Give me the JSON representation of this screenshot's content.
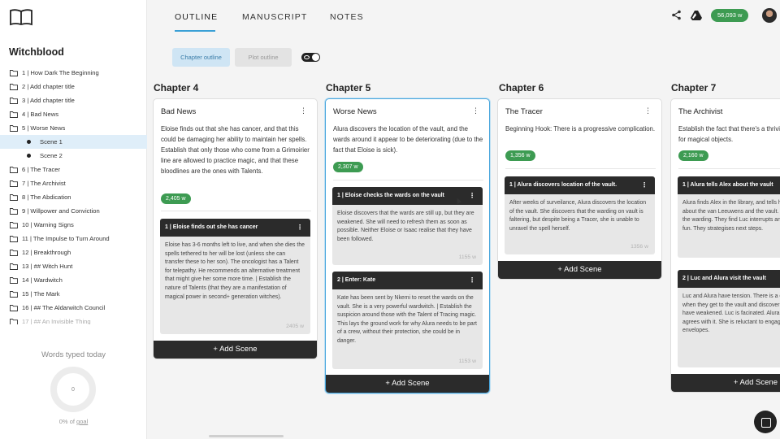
{
  "sidebar": {
    "project_title": "Witchblood",
    "chapters": [
      "1 | How Dark The Beginning",
      "2 | Add chapter title",
      "3 | Add chapter title",
      "4 | Bad News",
      "5 | Worse News",
      "6 | The Tracer",
      "7 | The Archivist",
      "8 | The Abdication",
      "9 | Willpower and Conviction",
      "10 | Warning Signs",
      "11 | The Impulse to Turn Around",
      "12 | Breakthrough",
      "13 | ## Witch Hunt",
      "14 | Wardwitch",
      "15 | The Mark",
      "16 | ## The Aldarwitch Council",
      "17 | ## An Invisible Thing"
    ],
    "scenes": [
      "Scene 1",
      "Scene 2"
    ],
    "words_label": "Words typed today",
    "words_value": "0",
    "goal_prefix": "0% of",
    "goal_link": "goal"
  },
  "tabs": [
    "OUTLINE",
    "MANUSCRIPT",
    "NOTES"
  ],
  "header": {
    "word_count": "56,093 w"
  },
  "toggles": {
    "chapter_outline": "Chapter outline",
    "plot_outline": "Plot outline"
  },
  "add_scene_label": "+ Add Scene",
  "columns": [
    {
      "chapter": "Chapter 4",
      "title": "Bad News",
      "summary": "Eloise finds out that she has cancer, and that this could be damaging her ability to maintain her spells. Establish that only those who come from a Grimoirier line are allowed to practice magic, and that these bloodlines are the ones with Talents.",
      "words": "2,405 w",
      "scenes": [
        {
          "title": "1 | Eloise finds out she has cancer",
          "body": "Eloise has 3-6 months left to live, and when she dies the spells tethered to her will be lost (unless she can transfer these to her son). The oncologist has a Talent for telepathy. He recommends an alternative treatment that might give her some more time. | Establish the nature of Talents (that they are a manifestation of magical power in second+ generation witches).",
          "words": "2405 w"
        }
      ]
    },
    {
      "chapter": "Chapter 5",
      "title": "Worse News",
      "summary": "Alura discovers the location of the vault, and the wards around it appear to be deteriorating (due to the fact that Eloise is sick).",
      "words": "2,307 w",
      "scenes": [
        {
          "title": "1 | Eloise checks the wards on the vault",
          "body": "Eloise discovers that the wards are still up, but they are weakened. She will need to refresh them as soon as possible. Neither Eloise or Isaac realise that they have been followed.",
          "words": "1155 w"
        },
        {
          "title": "2 | Enter: Kate",
          "body": "Kate has been sent by Nkemi to reset the wards on the vault. She is a very powerful wardwitch. | Establish the suspicion around those with the Talent of Tracing magic. This lays the ground work for why Alura needs to be part of a crew, without their protection, she could be in danger.",
          "words": "1153 w"
        }
      ]
    },
    {
      "chapter": "Chapter 6",
      "title": "The Tracer",
      "summary": "Beginning Hook: There is a progressive complication.",
      "words": "1,356 w",
      "scenes": [
        {
          "title": "1 | Alura discovers location of the vault.",
          "body": "After weeks of surveilance, Alura discovers the location of the vault. She discovers that the warding on vault is faltering, but despite being a Tracer, she is unable to unravel the spell herself.",
          "words": "1356 w"
        }
      ]
    },
    {
      "chapter": "Chapter 7",
      "title": "The Archivist",
      "summary": "Establish the fact that there's a thriving black market for magical objects.",
      "words": "2,160 w",
      "scenes": [
        {
          "title": "1 | Alura tells Alex about the vault",
          "body": "Alura finds Alex in the library, and tells him he was right about the van Leeuwens and the vault. Tells her about the warding. They find Luc interrupts and ruins Alura's fun. They strategises next steps.",
          "words": ""
        },
        {
          "title": "2 | Luc and Alura visit the vault",
          "body": "Luc and Alura have tension. There is a complication when they get to the vault and discover that the wards have weakened. Luc is facinated. Alura is shaken, but agrees with it. She is reluctant to engage with either envelopes.",
          "words": ""
        }
      ]
    }
  ]
}
